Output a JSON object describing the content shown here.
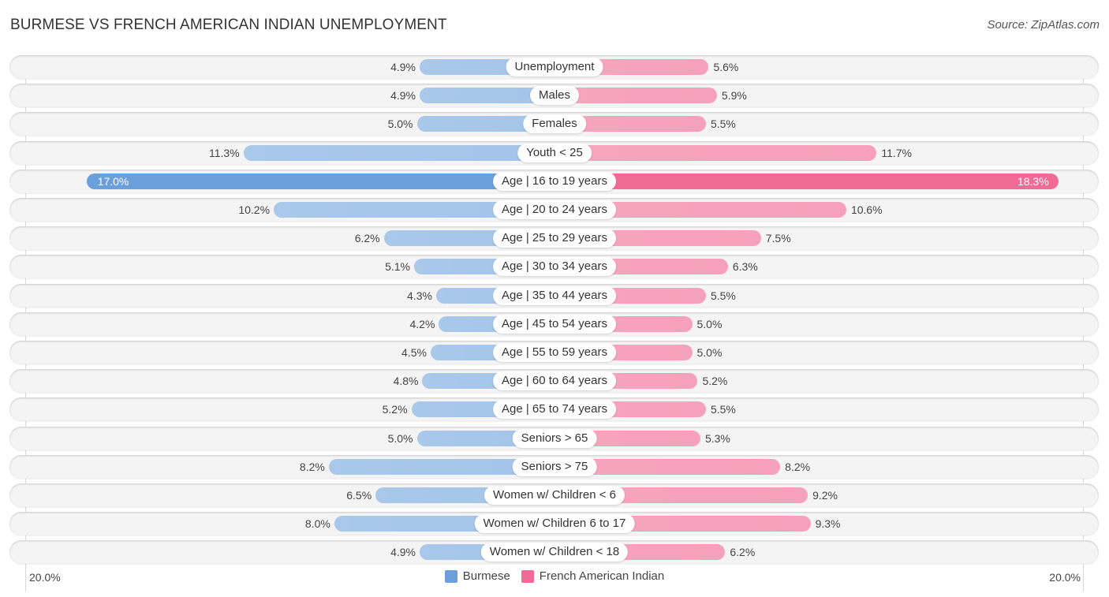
{
  "chart_data": {
    "type": "bar",
    "orientation": "horizontal-diverging",
    "title": "BURMESE VS FRENCH AMERICAN INDIAN UNEMPLOYMENT",
    "source": "Source: ZipAtlas.com",
    "unit": "%",
    "xlim": [
      -20,
      20
    ],
    "axis_labels": {
      "left": "20.0%",
      "right": "20.0%"
    },
    "categories": [
      "Unemployment",
      "Males",
      "Females",
      "Youth < 25",
      "Age | 16 to 19 years",
      "Age | 20 to 24 years",
      "Age | 25 to 29 years",
      "Age | 30 to 34 years",
      "Age | 35 to 44 years",
      "Age | 45 to 54 years",
      "Age | 55 to 59 years",
      "Age | 60 to 64 years",
      "Age | 65 to 74 years",
      "Seniors > 65",
      "Seniors > 75",
      "Women w/ Children < 6",
      "Women w/ Children 6 to 17",
      "Women w/ Children < 18"
    ],
    "series": [
      {
        "name": "Burmese",
        "color": "#6a9fdc",
        "side": "left",
        "values": [
          4.9,
          4.9,
          5.0,
          11.3,
          17.0,
          10.2,
          6.2,
          5.1,
          4.3,
          4.2,
          4.5,
          4.8,
          5.2,
          5.0,
          8.2,
          6.5,
          8.0,
          4.9
        ],
        "labels": [
          "4.9%",
          "4.9%",
          "5.0%",
          "11.3%",
          "17.0%",
          "10.2%",
          "6.2%",
          "5.1%",
          "4.3%",
          "4.2%",
          "4.5%",
          "4.8%",
          "5.2%",
          "5.0%",
          "8.2%",
          "6.5%",
          "8.0%",
          "4.9%"
        ]
      },
      {
        "name": "French American Indian",
        "color": "#f26b97",
        "side": "right",
        "values": [
          5.6,
          5.9,
          5.5,
          11.7,
          18.3,
          10.6,
          7.5,
          6.3,
          5.5,
          5.0,
          5.0,
          5.2,
          5.5,
          5.3,
          8.2,
          9.2,
          9.3,
          6.2
        ],
        "labels": [
          "5.6%",
          "5.9%",
          "5.5%",
          "11.7%",
          "18.3%",
          "10.6%",
          "7.5%",
          "6.3%",
          "5.5%",
          "5.0%",
          "5.0%",
          "5.2%",
          "5.5%",
          "5.3%",
          "8.2%",
          "9.2%",
          "9.3%",
          "6.2%"
        ]
      }
    ],
    "highlight_category": "Age | 16 to 19 years",
    "legend": {
      "position": "bottom-center",
      "entries": [
        "Burmese",
        "French American Indian"
      ]
    },
    "grid": false
  }
}
